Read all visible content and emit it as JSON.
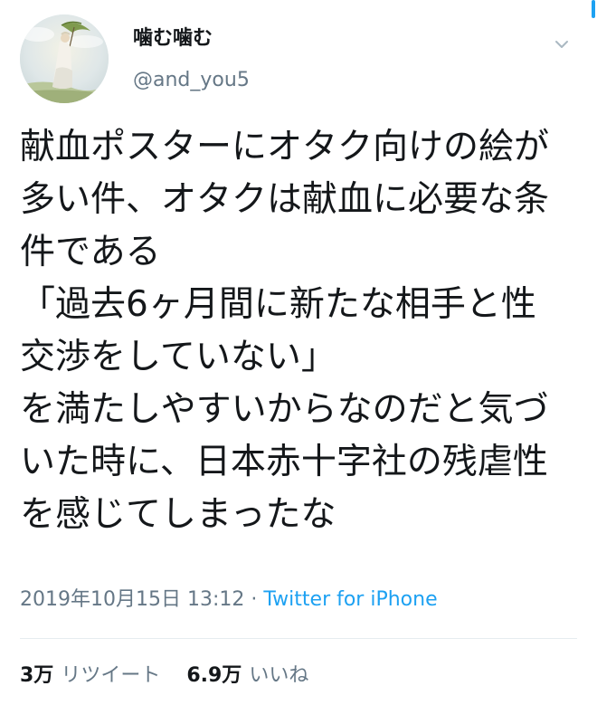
{
  "author": {
    "display_name": "噛む噛む",
    "handle": "@and_you5",
    "avatar_icon": "avatar-painting-woman-with-parasol"
  },
  "tweet": {
    "lines": [
      "献血ポスターにオタク向けの絵が",
      "多い件、オタクは献血に必要な条",
      "件である",
      "「過去6ヶ月間に新たな相手と性",
      "交渉をしていない」",
      "を満たしやすいからなのだと気づ",
      "いた時に、日本赤十字社の残虐性",
      "を感じてしまったな"
    ]
  },
  "meta": {
    "timestamp": "2019年10月15日 13:12",
    "separator": "·",
    "source": "Twitter for iPhone"
  },
  "stats": {
    "retweet_count": "3万",
    "retweet_label": "リツイート",
    "like_count": "6.9万",
    "like_label": "いいね"
  },
  "colors": {
    "text": "#14171a",
    "secondary": "#657786",
    "accent": "#1da1f2",
    "divider": "#e6ecf0"
  },
  "icons": {
    "menu": "chevron-down-icon"
  }
}
